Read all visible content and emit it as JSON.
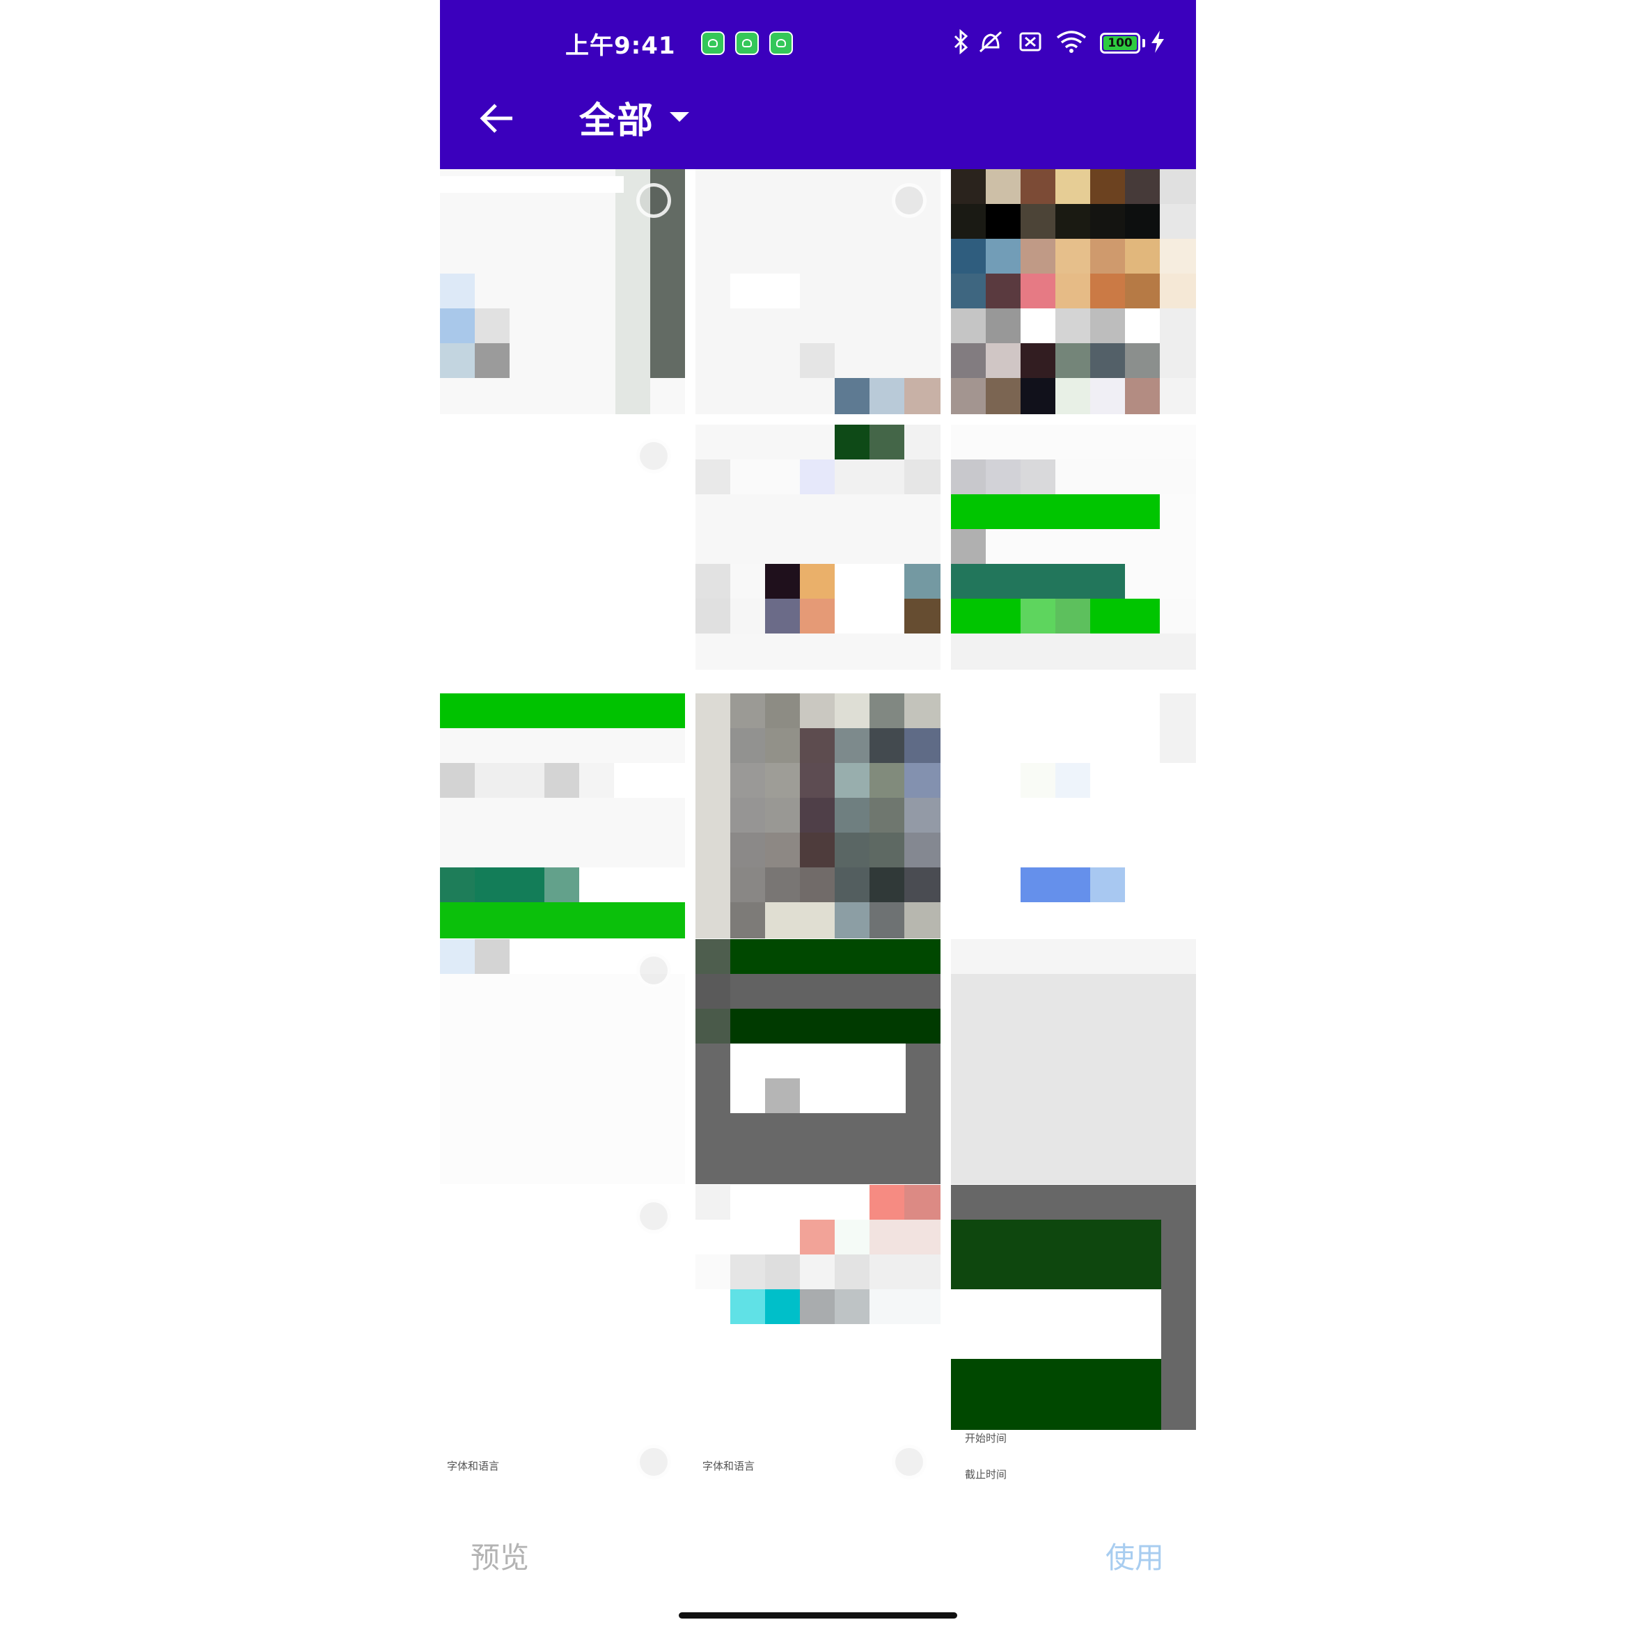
{
  "status_bar": {
    "time": "上午9:41",
    "battery_level": "100",
    "icons": [
      "bluetooth-icon",
      "vibrate-off-icon",
      "sim-off-icon",
      "wifi-icon",
      "battery-icon",
      "charging-icon"
    ]
  },
  "toolbar": {
    "album_title": "全部",
    "back_icon": "arrow-left-icon",
    "dropdown_icon": "caret-down-icon"
  },
  "grid": {
    "cells": [
      {
        "caption": ""
      },
      {
        "caption": ""
      },
      {
        "caption": ""
      },
      {
        "caption": ""
      },
      {
        "caption": ""
      },
      {
        "caption": ""
      },
      {
        "caption": ""
      },
      {
        "caption": ""
      },
      {
        "caption": ""
      },
      {
        "caption": ""
      },
      {
        "caption": ""
      },
      {
        "caption": ""
      },
      {
        "caption": "字体和语言"
      },
      {
        "caption": "字体和语言"
      },
      {
        "caption": "开始时间",
        "caption2": "截止时间"
      }
    ]
  },
  "bottom_bar": {
    "preview_label": "预览",
    "use_label": "使用"
  },
  "colors": {
    "toolbar_bg": "#3b00bd",
    "use_disabled": "#a8cdf0",
    "preview_disabled": "#b3b3b3"
  }
}
